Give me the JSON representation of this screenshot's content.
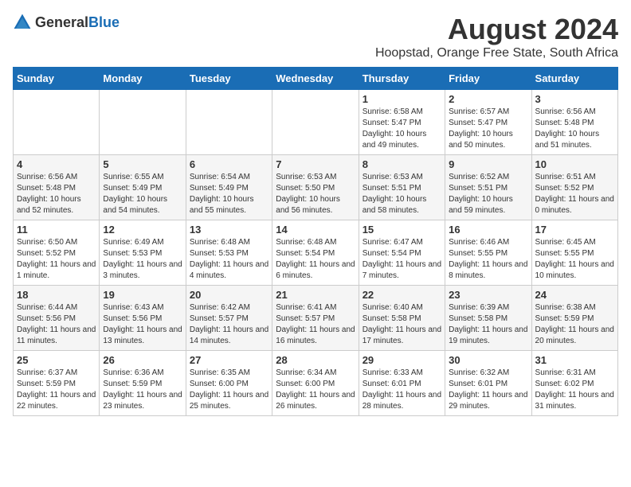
{
  "logo": {
    "general": "General",
    "blue": "Blue"
  },
  "title": "August 2024",
  "subtitle": "Hoopstad, Orange Free State, South Africa",
  "weekdays": [
    "Sunday",
    "Monday",
    "Tuesday",
    "Wednesday",
    "Thursday",
    "Friday",
    "Saturday"
  ],
  "weeks": [
    [
      {
        "day": "",
        "sunrise": "",
        "sunset": "",
        "daylight": ""
      },
      {
        "day": "",
        "sunrise": "",
        "sunset": "",
        "daylight": ""
      },
      {
        "day": "",
        "sunrise": "",
        "sunset": "",
        "daylight": ""
      },
      {
        "day": "",
        "sunrise": "",
        "sunset": "",
        "daylight": ""
      },
      {
        "day": "1",
        "sunrise": "Sunrise: 6:58 AM",
        "sunset": "Sunset: 5:47 PM",
        "daylight": "Daylight: 10 hours and 49 minutes."
      },
      {
        "day": "2",
        "sunrise": "Sunrise: 6:57 AM",
        "sunset": "Sunset: 5:47 PM",
        "daylight": "Daylight: 10 hours and 50 minutes."
      },
      {
        "day": "3",
        "sunrise": "Sunrise: 6:56 AM",
        "sunset": "Sunset: 5:48 PM",
        "daylight": "Daylight: 10 hours and 51 minutes."
      }
    ],
    [
      {
        "day": "4",
        "sunrise": "Sunrise: 6:56 AM",
        "sunset": "Sunset: 5:48 PM",
        "daylight": "Daylight: 10 hours and 52 minutes."
      },
      {
        "day": "5",
        "sunrise": "Sunrise: 6:55 AM",
        "sunset": "Sunset: 5:49 PM",
        "daylight": "Daylight: 10 hours and 54 minutes."
      },
      {
        "day": "6",
        "sunrise": "Sunrise: 6:54 AM",
        "sunset": "Sunset: 5:49 PM",
        "daylight": "Daylight: 10 hours and 55 minutes."
      },
      {
        "day": "7",
        "sunrise": "Sunrise: 6:53 AM",
        "sunset": "Sunset: 5:50 PM",
        "daylight": "Daylight: 10 hours and 56 minutes."
      },
      {
        "day": "8",
        "sunrise": "Sunrise: 6:53 AM",
        "sunset": "Sunset: 5:51 PM",
        "daylight": "Daylight: 10 hours and 58 minutes."
      },
      {
        "day": "9",
        "sunrise": "Sunrise: 6:52 AM",
        "sunset": "Sunset: 5:51 PM",
        "daylight": "Daylight: 10 hours and 59 minutes."
      },
      {
        "day": "10",
        "sunrise": "Sunrise: 6:51 AM",
        "sunset": "Sunset: 5:52 PM",
        "daylight": "Daylight: 11 hours and 0 minutes."
      }
    ],
    [
      {
        "day": "11",
        "sunrise": "Sunrise: 6:50 AM",
        "sunset": "Sunset: 5:52 PM",
        "daylight": "Daylight: 11 hours and 1 minute."
      },
      {
        "day": "12",
        "sunrise": "Sunrise: 6:49 AM",
        "sunset": "Sunset: 5:53 PM",
        "daylight": "Daylight: 11 hours and 3 minutes."
      },
      {
        "day": "13",
        "sunrise": "Sunrise: 6:48 AM",
        "sunset": "Sunset: 5:53 PM",
        "daylight": "Daylight: 11 hours and 4 minutes."
      },
      {
        "day": "14",
        "sunrise": "Sunrise: 6:48 AM",
        "sunset": "Sunset: 5:54 PM",
        "daylight": "Daylight: 11 hours and 6 minutes."
      },
      {
        "day": "15",
        "sunrise": "Sunrise: 6:47 AM",
        "sunset": "Sunset: 5:54 PM",
        "daylight": "Daylight: 11 hours and 7 minutes."
      },
      {
        "day": "16",
        "sunrise": "Sunrise: 6:46 AM",
        "sunset": "Sunset: 5:55 PM",
        "daylight": "Daylight: 11 hours and 8 minutes."
      },
      {
        "day": "17",
        "sunrise": "Sunrise: 6:45 AM",
        "sunset": "Sunset: 5:55 PM",
        "daylight": "Daylight: 11 hours and 10 minutes."
      }
    ],
    [
      {
        "day": "18",
        "sunrise": "Sunrise: 6:44 AM",
        "sunset": "Sunset: 5:56 PM",
        "daylight": "Daylight: 11 hours and 11 minutes."
      },
      {
        "day": "19",
        "sunrise": "Sunrise: 6:43 AM",
        "sunset": "Sunset: 5:56 PM",
        "daylight": "Daylight: 11 hours and 13 minutes."
      },
      {
        "day": "20",
        "sunrise": "Sunrise: 6:42 AM",
        "sunset": "Sunset: 5:57 PM",
        "daylight": "Daylight: 11 hours and 14 minutes."
      },
      {
        "day": "21",
        "sunrise": "Sunrise: 6:41 AM",
        "sunset": "Sunset: 5:57 PM",
        "daylight": "Daylight: 11 hours and 16 minutes."
      },
      {
        "day": "22",
        "sunrise": "Sunrise: 6:40 AM",
        "sunset": "Sunset: 5:58 PM",
        "daylight": "Daylight: 11 hours and 17 minutes."
      },
      {
        "day": "23",
        "sunrise": "Sunrise: 6:39 AM",
        "sunset": "Sunset: 5:58 PM",
        "daylight": "Daylight: 11 hours and 19 minutes."
      },
      {
        "day": "24",
        "sunrise": "Sunrise: 6:38 AM",
        "sunset": "Sunset: 5:59 PM",
        "daylight": "Daylight: 11 hours and 20 minutes."
      }
    ],
    [
      {
        "day": "25",
        "sunrise": "Sunrise: 6:37 AM",
        "sunset": "Sunset: 5:59 PM",
        "daylight": "Daylight: 11 hours and 22 minutes."
      },
      {
        "day": "26",
        "sunrise": "Sunrise: 6:36 AM",
        "sunset": "Sunset: 5:59 PM",
        "daylight": "Daylight: 11 hours and 23 minutes."
      },
      {
        "day": "27",
        "sunrise": "Sunrise: 6:35 AM",
        "sunset": "Sunset: 6:00 PM",
        "daylight": "Daylight: 11 hours and 25 minutes."
      },
      {
        "day": "28",
        "sunrise": "Sunrise: 6:34 AM",
        "sunset": "Sunset: 6:00 PM",
        "daylight": "Daylight: 11 hours and 26 minutes."
      },
      {
        "day": "29",
        "sunrise": "Sunrise: 6:33 AM",
        "sunset": "Sunset: 6:01 PM",
        "daylight": "Daylight: 11 hours and 28 minutes."
      },
      {
        "day": "30",
        "sunrise": "Sunrise: 6:32 AM",
        "sunset": "Sunset: 6:01 PM",
        "daylight": "Daylight: 11 hours and 29 minutes."
      },
      {
        "day": "31",
        "sunrise": "Sunrise: 6:31 AM",
        "sunset": "Sunset: 6:02 PM",
        "daylight": "Daylight: 11 hours and 31 minutes."
      }
    ]
  ]
}
